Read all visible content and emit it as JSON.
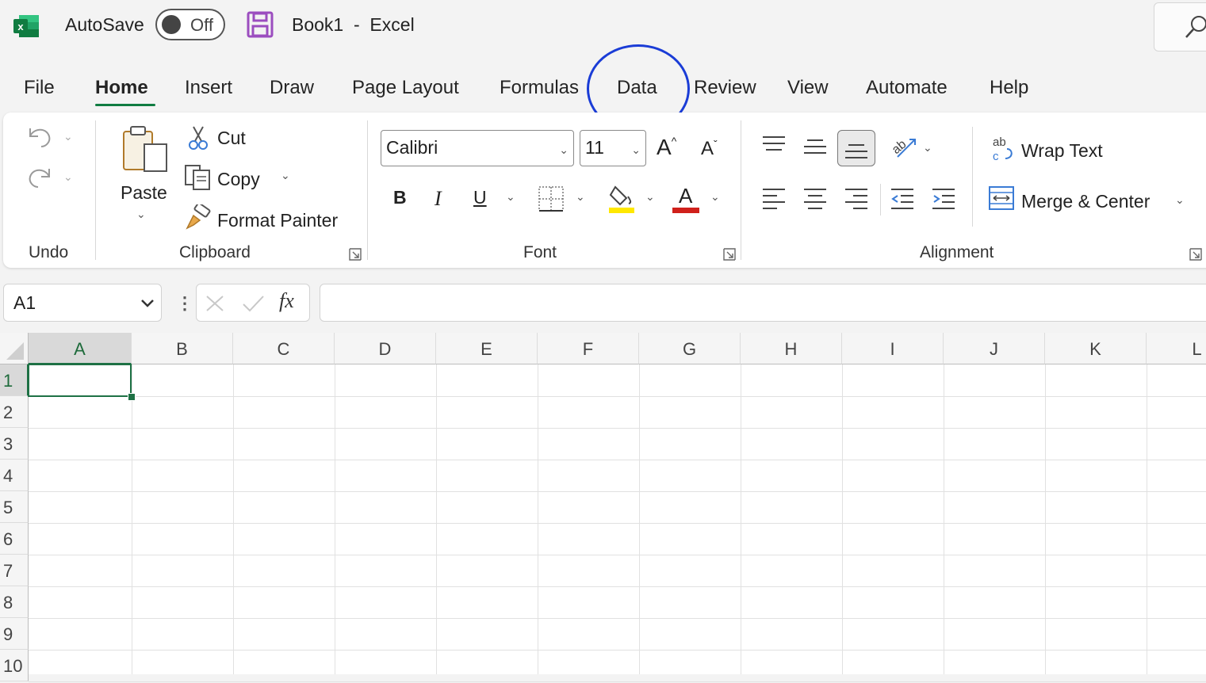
{
  "titlebar": {
    "autosave_label": "AutoSave",
    "autosave_state": "Off",
    "document_title": "Book1  -  Excel"
  },
  "menu": {
    "tabs": [
      "File",
      "Home",
      "Insert",
      "Draw",
      "Page Layout",
      "Formulas",
      "Data",
      "Review",
      "View",
      "Automate",
      "Help"
    ],
    "active_tab": "Home",
    "highlighted_tab": "Data"
  },
  "ribbon": {
    "undo_group": "Undo",
    "clipboard": {
      "group": "Clipboard",
      "paste": "Paste",
      "cut": "Cut",
      "copy": "Copy",
      "format_painter": "Format Painter"
    },
    "font": {
      "group": "Font",
      "font_name": "Calibri",
      "font_size": "11",
      "bold": "B",
      "italic": "I",
      "underline": "U",
      "grow": "A",
      "shrink": "A",
      "font_color_letter": "A"
    },
    "alignment": {
      "group": "Alignment",
      "wrap_text": "Wrap Text",
      "merge_center": "Merge & Center"
    }
  },
  "formula_bar": {
    "name_box": "A1",
    "fx": "fx",
    "formula_value": ""
  },
  "grid": {
    "columns": [
      "A",
      "B",
      "C",
      "D",
      "E",
      "F",
      "G",
      "H",
      "I",
      "J",
      "K",
      "L"
    ],
    "rows": [
      "1",
      "2",
      "3",
      "4",
      "5",
      "6",
      "7",
      "8",
      "9",
      "10"
    ],
    "selected_cell": "A1"
  },
  "colors": {
    "excel_green": "#107c41",
    "highlight_circle": "#1a3cd6",
    "save_purple": "#9b4dbf",
    "font_color_red": "#d0201b",
    "highlight_yellow": "#ffe800"
  }
}
